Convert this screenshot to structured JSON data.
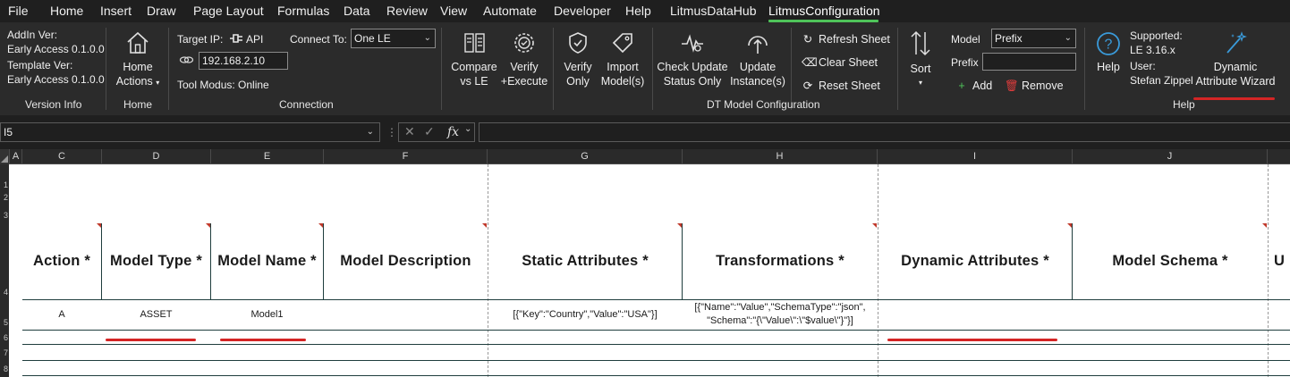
{
  "menu": {
    "items": [
      "File",
      "Home",
      "Insert",
      "Draw",
      "Page Layout",
      "Formulas",
      "Data",
      "Review",
      "View",
      "Automate",
      "Developer",
      "Help",
      "LitmusDataHub",
      "LitmusConfiguration"
    ],
    "active": "LitmusConfiguration"
  },
  "ribbon": {
    "version_info": {
      "addin_label": "AddIn Ver:",
      "addin_value": "Early Access 0.1.0.0",
      "template_label": "Template Ver:",
      "template_value": "Early Access 0.1.0.0",
      "group_label": "Version Info"
    },
    "home": {
      "button_line1": "Home",
      "button_line2": "Actions",
      "group_label": "Home"
    },
    "connection": {
      "target_ip_label": "Target IP:",
      "api_label": "API",
      "ip_value": "192.168.2.10",
      "connect_to_label": "Connect To:",
      "connect_to_value": "One LE",
      "tool_mode": "Tool Modus: Online",
      "group_label": "Connection"
    },
    "dt_model": {
      "compare_line1": "Compare",
      "compare_line2": "vs LE",
      "verify_execute_line1": "Verify",
      "verify_execute_line2": "+Execute",
      "verify_only_line1": "Verify",
      "verify_only_line2": "Only",
      "import_line1": "Import",
      "import_line2": "Model(s)",
      "check_update_line1": "Check Update",
      "check_update_line2": "Status Only",
      "update_instance_line1": "Update",
      "update_instance_line2": "Instance(s)",
      "refresh_sheet": "Refresh Sheet",
      "clear_sheet": "Clear Sheet",
      "reset_sheet": "Reset Sheet",
      "sort_label": "Sort",
      "model_label": "Model",
      "model_value": "Prefix",
      "prefix_label": "Prefix",
      "prefix_value": "",
      "add_label": "Add",
      "remove_label": "Remove",
      "group_label": "DT Model Configuration"
    },
    "help": {
      "help_label": "Help",
      "supported_label": "Supported:",
      "supported_value": "LE 3.16.x",
      "user_label": "User:",
      "user_value": "Stefan Zippel",
      "wizard_line1": "Dynamic",
      "wizard_line2": "Attribute Wizard",
      "group_label": "Help"
    }
  },
  "formula_bar": {
    "name_box": "I5",
    "fx_label": "fx",
    "formula": ""
  },
  "columns": [
    "A",
    "C",
    "D",
    "E",
    "F",
    "G",
    "H",
    "I",
    "J"
  ],
  "rows": [
    "1",
    "2",
    "3",
    "4",
    "5",
    "6",
    "7",
    "8"
  ],
  "headers": {
    "action": "Action *",
    "model_type": "Model Type *",
    "model_name": "Model Name *",
    "model_description": "Model Description",
    "static_attributes": "Static Attributes *",
    "transformations": "Transformations *",
    "dynamic_attributes": "Dynamic Attributes *",
    "model_schema": "Model Schema *",
    "next_partial": "U"
  },
  "row5": {
    "action": "A",
    "model_type": "ASSET",
    "model_name": "Model1",
    "static_attributes": "[{\"Key\":\"Country\",\"Value\":\"USA\"}]",
    "transformations_line1": "[{\"Name\":\"Value\",\"SchemaType\":\"json\",",
    "transformations_line2": "\"Schema\":\"{\\\"Value\\\":\\\"$value\\\"}\"}]"
  },
  "colors": {
    "accent_tab": "#4fc35a",
    "annotation_red": "#d42525",
    "help_icon": "#3a9ad9"
  }
}
